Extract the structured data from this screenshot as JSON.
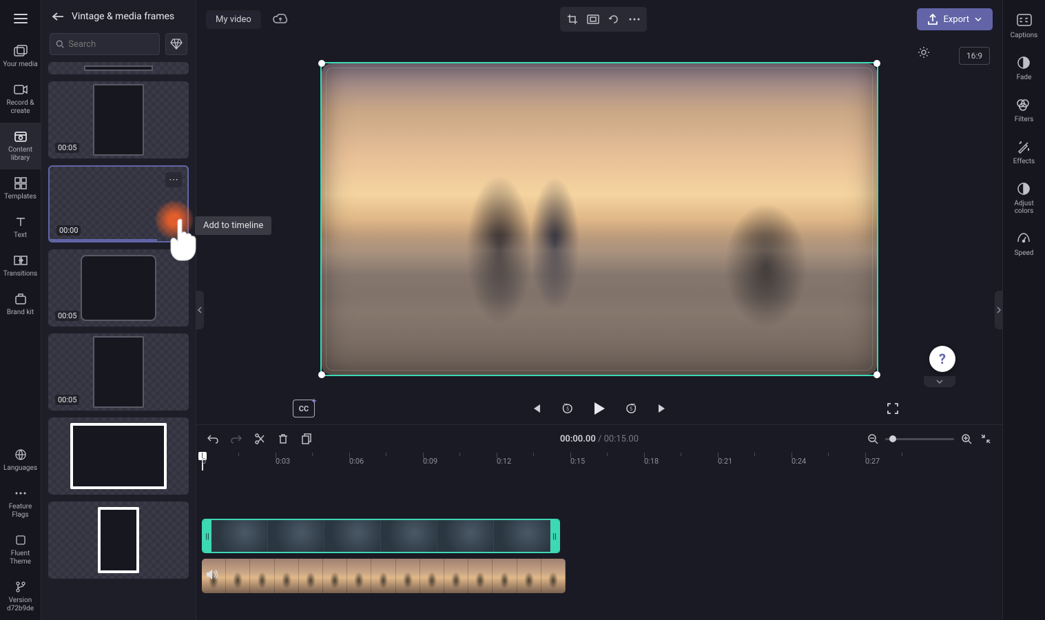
{
  "nav": {
    "items": [
      {
        "label": "Your media"
      },
      {
        "label": "Record & create"
      },
      {
        "label": "Content library"
      },
      {
        "label": "Templates"
      },
      {
        "label": "Text"
      },
      {
        "label": "Transitions"
      },
      {
        "label": "Brand kit"
      }
    ],
    "bottom_items": [
      {
        "label": "Languages"
      },
      {
        "label": "Feature Flags"
      },
      {
        "label": "Fluent Theme"
      },
      {
        "label": "Version d72b9de"
      }
    ]
  },
  "panel": {
    "title": "Vintage & media frames",
    "search_placeholder": "Search",
    "frames": [
      {
        "duration": "00:05"
      },
      {
        "duration": "00:00",
        "selected": true
      },
      {
        "duration": "00:05"
      },
      {
        "duration": "00:05"
      },
      {
        "duration": ""
      },
      {
        "duration": ""
      }
    ]
  },
  "tooltip": "Add to timeline",
  "top": {
    "title": "My video",
    "export": "Export",
    "aspect": "16:9"
  },
  "right_rail": {
    "items": [
      {
        "label": "Captions"
      },
      {
        "label": "Fade"
      },
      {
        "label": "Filters"
      },
      {
        "label": "Effects"
      },
      {
        "label": "Adjust colors"
      },
      {
        "label": "Speed"
      }
    ]
  },
  "playback": {
    "cc": "CC"
  },
  "timeline": {
    "current": "00:00.00",
    "separator": " / ",
    "total": "00:15.00",
    "marks": [
      "0",
      "0:03",
      "0:06",
      "0:09",
      "0:12",
      "0:15",
      "0:18",
      "0:21",
      "0:24",
      "0:27"
    ]
  },
  "help": "?"
}
